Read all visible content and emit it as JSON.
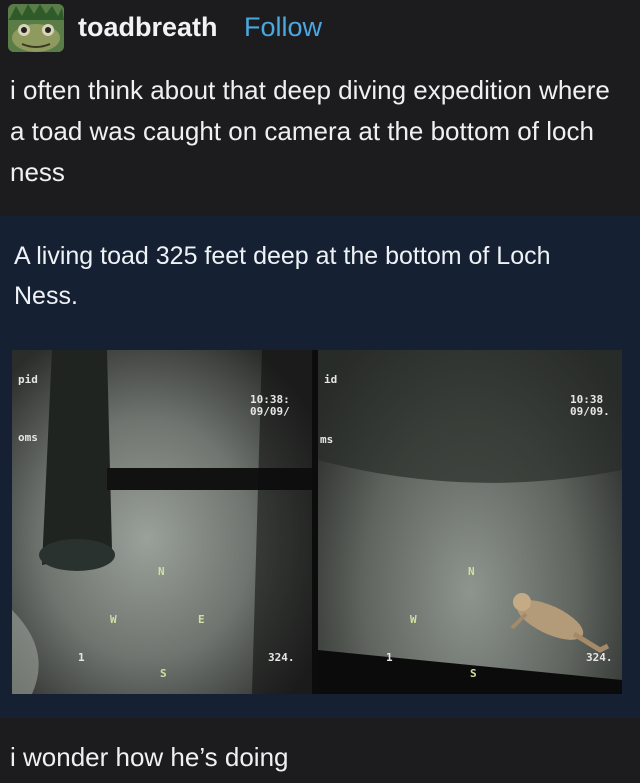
{
  "post": {
    "username": "toadbreath",
    "follow_label": "Follow",
    "avatar_icon": "frog-avatar-icon",
    "text": "i often think about that deep diving expedition where a toad was caught on camera at the bottom of loch ness",
    "link_color": "#4aa8e0"
  },
  "quoted": {
    "text": "A living toad 325 feet deep at the bottom of Loch Ness.",
    "background": "#152132"
  },
  "photo": {
    "left_cam": {
      "label_top": "pid",
      "label_mid": "oms",
      "time": "10:38:",
      "date": "09/09/",
      "compass_n": "N",
      "compass_w": "W",
      "compass_e": "E",
      "compass_s": "S",
      "marker": "1",
      "depth": "324."
    },
    "right_cam": {
      "label_top": "id",
      "label_mid": "ms",
      "time": "10:38",
      "date": "09/09.",
      "compass_n": "N",
      "compass_w": "W",
      "compass_s": "S",
      "marker": "1",
      "depth": "324."
    }
  },
  "footer": {
    "text": "i wonder how he’s doing"
  }
}
